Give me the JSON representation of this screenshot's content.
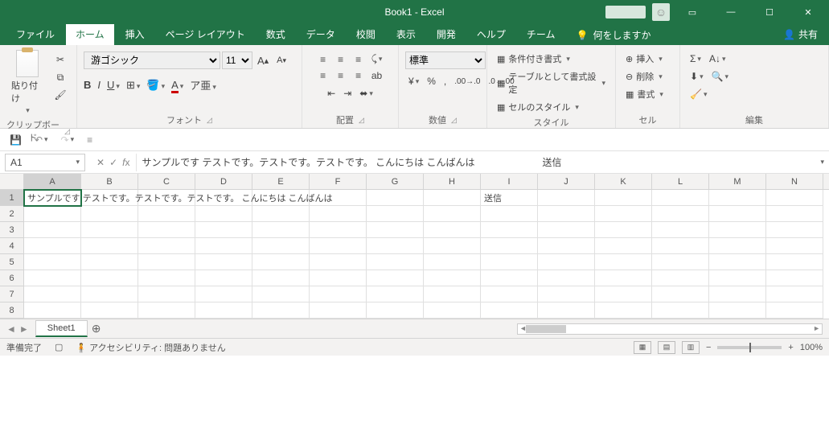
{
  "title": "Book1  -  Excel",
  "tabs": {
    "file": "ファイル",
    "home": "ホーム",
    "insert": "挿入",
    "layout": "ページ レイアウト",
    "formula": "数式",
    "data": "データ",
    "review": "校閲",
    "view": "表示",
    "dev": "開発",
    "help": "ヘルプ",
    "team": "チーム"
  },
  "tellme": "何をしますか",
  "share": "共有",
  "ribbon": {
    "clipboard": {
      "paste": "貼り付け",
      "label": "クリップボード"
    },
    "font": {
      "name": "游ゴシック",
      "size": "11",
      "label": "フォント"
    },
    "align": {
      "label": "配置",
      "wrap": "折り返して全体を表示する",
      "merge": "セルを結合して中央揃え"
    },
    "number": {
      "label": "数値",
      "format": "標準"
    },
    "styles": {
      "label": "スタイル",
      "cond": "条件付き書式",
      "table": "テーブルとして書式設定",
      "cell": "セルのスタイル"
    },
    "cells": {
      "label": "セル",
      "insert": "挿入",
      "delete": "削除",
      "format": "書式"
    },
    "edit": {
      "label": "編集"
    }
  },
  "namebox": "A1",
  "formula": "サンプルです テストです。テストです。テストです。 こんにちは こんばんは　　　　　　　送信",
  "cols": [
    "A",
    "B",
    "C",
    "D",
    "E",
    "F",
    "G",
    "H",
    "I",
    "J",
    "K",
    "L",
    "M",
    "N"
  ],
  "rowCount": 8,
  "cellsData": {
    "A1": "サンプルです テストです。テストです。テストです。 こんにちは こんばんは",
    "I1": "送信"
  },
  "sheet": "Sheet1",
  "status": {
    "ready": "準備完了",
    "a11y": "アクセシビリティ: 問題ありません",
    "zoom": "100%"
  }
}
